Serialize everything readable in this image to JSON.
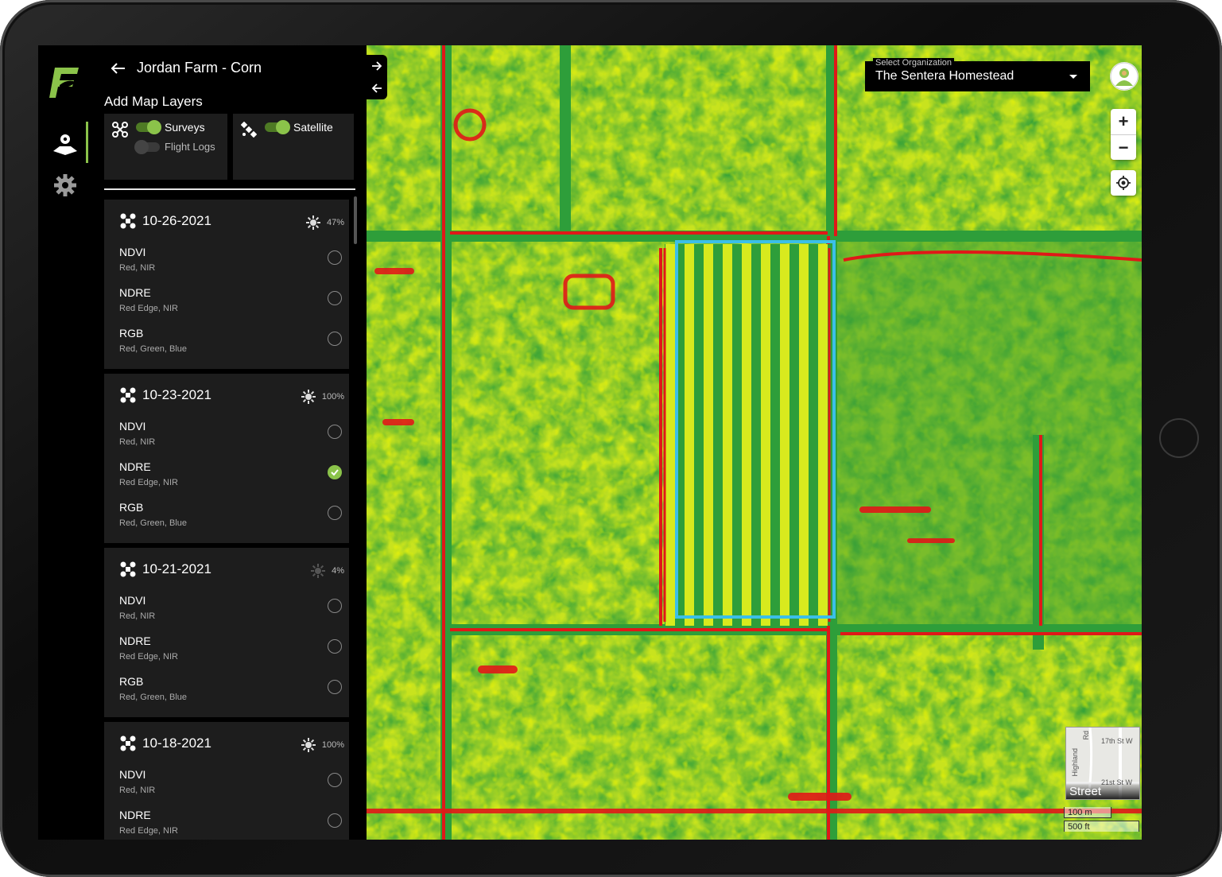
{
  "colors": {
    "accent": "#8bc34a",
    "panel_card": "#1d1d1d",
    "field_outline": "#3bbfe8",
    "ndvi_high": "#2e9e3a",
    "ndvi_mid": "#e4f024",
    "ndvi_low": "#e01818"
  },
  "rail": {
    "logo_icon": "sentera-logo",
    "items": [
      {
        "icon": "map-pin-icon",
        "active": true
      },
      {
        "icon": "gear-icon",
        "active": false
      }
    ]
  },
  "panel": {
    "back_icon": "arrow-left-icon",
    "title": "Jordan Farm - Corn",
    "layers_title": "Add Map Layers",
    "layer_cards": [
      {
        "icon": "drone-icon",
        "toggles": [
          {
            "label": "Surveys",
            "on": true
          },
          {
            "label": "Flight Logs",
            "on": false
          }
        ]
      },
      {
        "icon": "satellite-icon",
        "toggles": [
          {
            "label": "Satellite",
            "on": true
          }
        ]
      }
    ],
    "surveys": [
      {
        "date": "10-26-2021",
        "coverage": "47%",
        "layers": [
          {
            "name": "NDVI",
            "bands": "Red, NIR",
            "checked": false
          },
          {
            "name": "NDRE",
            "bands": "Red Edge, NIR",
            "checked": false
          },
          {
            "name": "RGB",
            "bands": "Red, Green, Blue",
            "checked": false
          }
        ]
      },
      {
        "date": "10-23-2021",
        "coverage": "100%",
        "layers": [
          {
            "name": "NDVI",
            "bands": "Red, NIR",
            "checked": false
          },
          {
            "name": "NDRE",
            "bands": "Red Edge, NIR",
            "checked": true
          },
          {
            "name": "RGB",
            "bands": "Red, Green, Blue",
            "checked": false
          }
        ]
      },
      {
        "date": "10-21-2021",
        "coverage": "4%",
        "layers": [
          {
            "name": "NDVI",
            "bands": "Red, NIR",
            "checked": false
          },
          {
            "name": "NDRE",
            "bands": "Red Edge, NIR",
            "checked": false
          },
          {
            "name": "RGB",
            "bands": "Red, Green, Blue",
            "checked": false
          }
        ]
      },
      {
        "date": "10-18-2021",
        "coverage": "100%",
        "layers": [
          {
            "name": "NDVI",
            "bands": "Red, NIR",
            "checked": false
          },
          {
            "name": "NDRE",
            "bands": "Red Edge, NIR",
            "checked": false
          }
        ]
      }
    ]
  },
  "map": {
    "org_select": {
      "label": "Select Organization",
      "value": "The Sentera Homestead"
    },
    "zoom_in": "+",
    "zoom_out": "−",
    "basemap": {
      "label": "Street",
      "streets": [
        "17th St W",
        "21st St W",
        "Highland",
        "Rd"
      ]
    },
    "scale": {
      "metric": "100 m",
      "imperial": "500 ft"
    }
  }
}
